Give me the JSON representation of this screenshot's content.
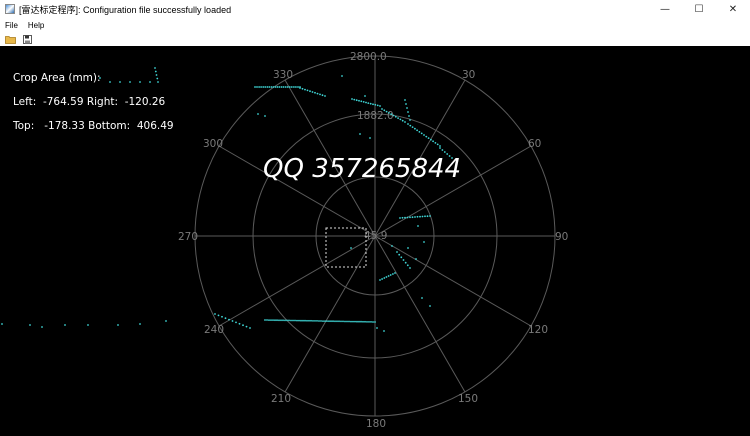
{
  "window": {
    "title": "[雷达标定程序]: Configuration file successfully loaded",
    "minimize_glyph": "—",
    "maximize_glyph": "☐",
    "close_glyph": "✕"
  },
  "menu": [
    {
      "label": "File"
    },
    {
      "label": "Help"
    }
  ],
  "toolbar": {
    "open_icon": "folder-open-icon",
    "save_icon": "save-icon"
  },
  "radar": {
    "range_labels": [
      "2800.0",
      "1882.0",
      "45.9"
    ],
    "angle_labels": [
      "330",
      "30",
      "300",
      "60",
      "270",
      "90",
      "240",
      "120",
      "210",
      "150",
      "180"
    ],
    "crop_area": {
      "title": "Crop Area (mm):",
      "left_right": "Left:  -764.59 Right:  -120.26",
      "top_bottom": "Top:   -178.33 Bottom:  406.49"
    },
    "watermark": "QQ 357265844",
    "colors": {
      "background": "#000000",
      "grid": "#5a5a5a",
      "points": "#3fd6d6",
      "crop_box": "#dcdcdc"
    }
  }
}
